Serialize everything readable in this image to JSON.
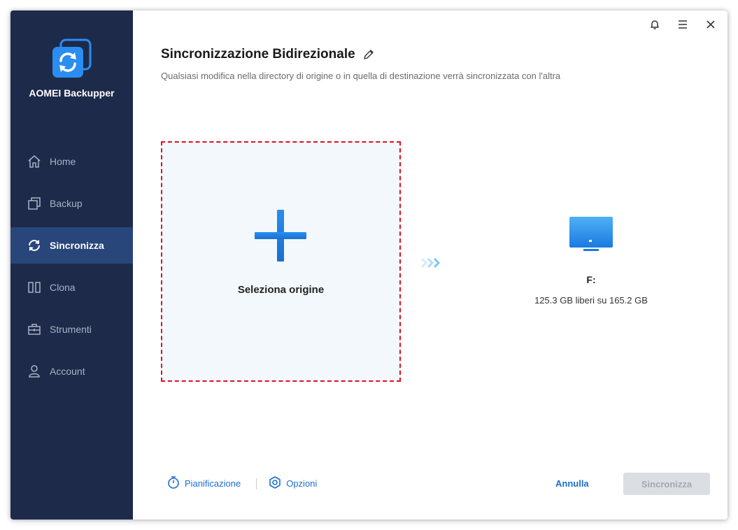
{
  "app": {
    "name": "AOMEI Backupper",
    "accent_color": "#1a6fcf",
    "sidebar_color": "#1d2a4a",
    "active_color": "#28467a"
  },
  "sidebar": {
    "items": [
      {
        "label": "Home",
        "icon": "home-icon"
      },
      {
        "label": "Backup",
        "icon": "backup-icon"
      },
      {
        "label": "Sincronizza",
        "icon": "sync-icon",
        "active": true
      },
      {
        "label": "Clona",
        "icon": "clone-icon"
      },
      {
        "label": "Strumenti",
        "icon": "toolbox-icon"
      },
      {
        "label": "Account",
        "icon": "user-icon"
      }
    ]
  },
  "window_controls": [
    "bell-icon",
    "menu-icon",
    "close-icon"
  ],
  "main": {
    "title": "Sincronizzazione Bidirezionale",
    "subtitle": "Qualsiasi modifica nella directory di origine o in quella di destinazione verrà sincronizzata con l'altra",
    "source": {
      "label": "Seleziona origine",
      "border_color": "#e0101e"
    },
    "destination": {
      "label": "F:",
      "space": "125.3 GB liberi su 165.2 GB"
    }
  },
  "footer": {
    "schedule_label": "Pianificazione",
    "options_label": "Opzioni",
    "cancel_label": "Annulla",
    "sync_label": "Sincronizza"
  }
}
